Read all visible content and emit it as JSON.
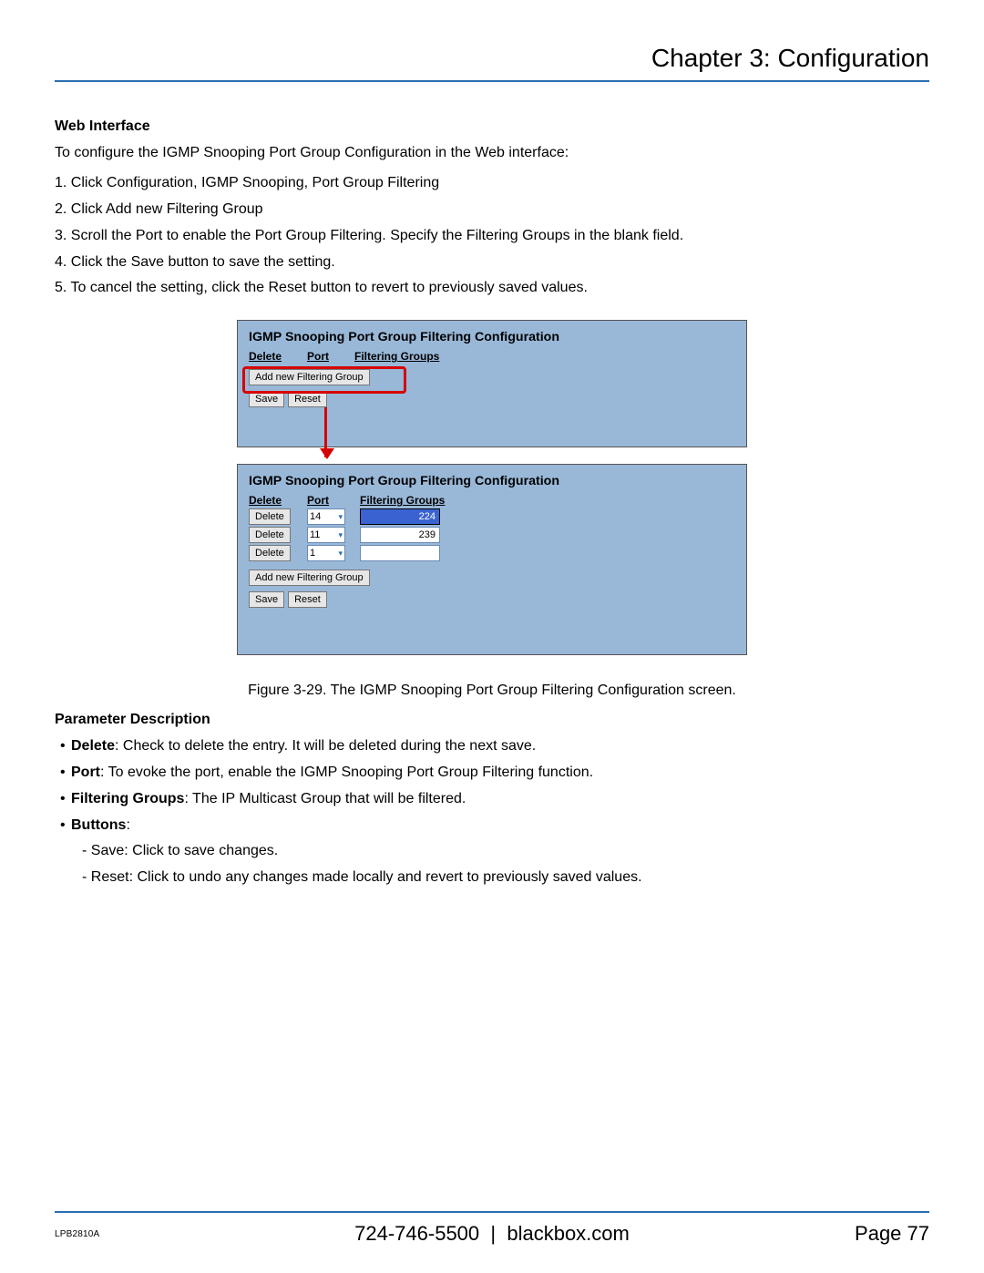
{
  "header": {
    "chapter_title": "Chapter 3: Configuration"
  },
  "intro": {
    "section_title": "Web Interface",
    "lead": "To configure the IGMP Snooping Port Group Configuration in the Web interface:",
    "steps": [
      "1. Click Configuration, IGMP Snooping, Port Group Filtering",
      "2. Click Add new Filtering Group",
      "3. Scroll the Port to enable the Port Group Filtering. Specify the Filtering Groups in the blank field.",
      "4. Click the Save button to save the setting.",
      "5. To cancel the setting, click the Reset button to revert to previously saved values."
    ]
  },
  "figure": {
    "panel_heading": "IGMP Snooping Port Group Filtering Configuration",
    "columns": {
      "delete": "Delete",
      "port": "Port",
      "filtering_groups": "Filtering Groups"
    },
    "add_button": "Add new Filtering Group",
    "save": "Save",
    "reset": "Reset",
    "delete_btn": "Delete",
    "rows": [
      {
        "port": "14",
        "group": "224",
        "highlight": true
      },
      {
        "port": "11",
        "group": "239",
        "highlight": false
      },
      {
        "port": "1",
        "group": "",
        "highlight": false
      }
    ],
    "caption": "Figure 3-29. The IGMP Snooping Port Group Filtering Configuration screen."
  },
  "params": {
    "section_title": "Parameter Description",
    "items": [
      {
        "term": "Delete",
        "desc": ": Check to delete the entry. It will be deleted during the next save."
      },
      {
        "term": "Port",
        "desc": ": To evoke the port, enable the IGMP Snooping Port Group Filtering function."
      },
      {
        "term": "Filtering Groups",
        "desc": ": The IP Multicast Group that will be filtered."
      },
      {
        "term": "Buttons",
        "desc": ":"
      }
    ],
    "sub_items": [
      "- Save: Click to save changes.",
      "- Reset: Click to undo any changes made locally and revert to previously saved values."
    ]
  },
  "footer": {
    "model": "LPB2810A",
    "phone": "724-746-5500",
    "sep": "|",
    "site": "blackbox.com",
    "page_label": "Page 77"
  }
}
